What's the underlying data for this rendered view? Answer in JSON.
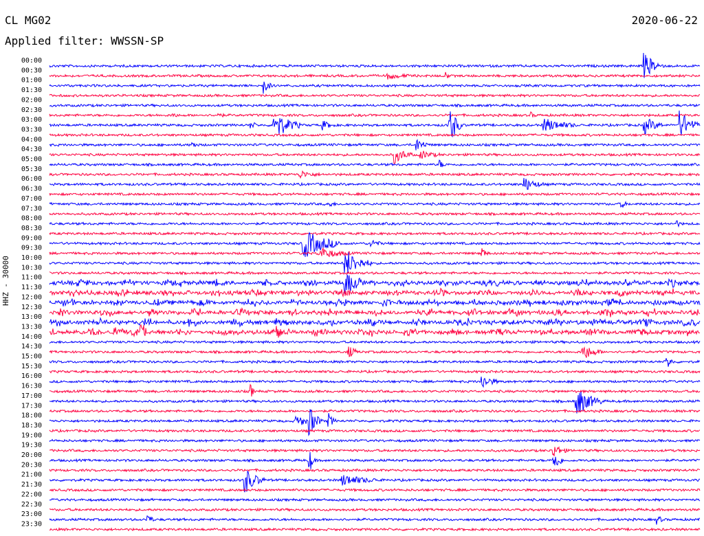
{
  "header": {
    "station": "CL MG02",
    "date": "2020-06-22",
    "filter": "Applied filter: WWSSN-SP",
    "ylabel": "HHZ - 30000"
  },
  "colors": {
    "trace_a": "#0000ff",
    "trace_b": "#ff0040",
    "text": "#000000"
  },
  "chart_data": {
    "type": "line",
    "description_type": "helicorder",
    "rows": [
      "00:00",
      "00:30",
      "01:00",
      "01:30",
      "02:00",
      "02:30",
      "03:00",
      "03:30",
      "04:00",
      "04:30",
      "05:00",
      "05:30",
      "06:00",
      "06:30",
      "07:00",
      "07:30",
      "08:00",
      "08:30",
      "09:00",
      "09:30",
      "10:00",
      "10:30",
      "11:00",
      "11:30",
      "12:00",
      "12:30",
      "13:00",
      "13:30",
      "14:00",
      "14:30",
      "15:00",
      "15:30",
      "16:00",
      "16:30",
      "17:00",
      "17:30",
      "18:00",
      "18:30",
      "19:00",
      "19:30",
      "20:00",
      "20:30",
      "21:00",
      "21:30",
      "22:00",
      "22:30",
      "23:00",
      "23:30"
    ],
    "row_minutes": 30,
    "series_colors": [
      "blue",
      "red"
    ],
    "events": [
      {
        "row": 0,
        "pos": 0.915,
        "amp": 18,
        "dur": 0.03
      },
      {
        "row": 1,
        "pos": 0.52,
        "amp": 4,
        "dur": 0.04
      },
      {
        "row": 1,
        "pos": 0.61,
        "amp": 6,
        "dur": 0.005
      },
      {
        "row": 2,
        "pos": 0.33,
        "amp": 12,
        "dur": 0.012
      },
      {
        "row": 5,
        "pos": 0.19,
        "amp": 4,
        "dur": 0.008
      },
      {
        "row": 5,
        "pos": 0.26,
        "amp": 4,
        "dur": 0.008
      },
      {
        "row": 5,
        "pos": 0.74,
        "amp": 4,
        "dur": 0.008
      },
      {
        "row": 6,
        "pos": 0.31,
        "amp": 5,
        "dur": 0.01
      },
      {
        "row": 6,
        "pos": 0.345,
        "amp": 22,
        "dur": 0.04
      },
      {
        "row": 6,
        "pos": 0.42,
        "amp": 6,
        "dur": 0.02
      },
      {
        "row": 6,
        "pos": 0.615,
        "amp": 30,
        "dur": 0.02
      },
      {
        "row": 6,
        "pos": 0.76,
        "amp": 10,
        "dur": 0.05
      },
      {
        "row": 6,
        "pos": 0.915,
        "amp": 12,
        "dur": 0.03
      },
      {
        "row": 6,
        "pos": 0.97,
        "amp": 20,
        "dur": 0.03
      },
      {
        "row": 8,
        "pos": 0.22,
        "amp": 4,
        "dur": 0.01
      },
      {
        "row": 8,
        "pos": 0.565,
        "amp": 9,
        "dur": 0.02
      },
      {
        "row": 9,
        "pos": 0.53,
        "amp": 12,
        "dur": 0.03
      },
      {
        "row": 9,
        "pos": 0.57,
        "amp": 6,
        "dur": 0.03
      },
      {
        "row": 10,
        "pos": 0.6,
        "amp": 6,
        "dur": 0.01
      },
      {
        "row": 11,
        "pos": 0.385,
        "amp": 5,
        "dur": 0.03
      },
      {
        "row": 12,
        "pos": 0.73,
        "amp": 10,
        "dur": 0.03
      },
      {
        "row": 14,
        "pos": 0.43,
        "amp": 4,
        "dur": 0.01
      },
      {
        "row": 14,
        "pos": 0.88,
        "amp": 5,
        "dur": 0.01
      },
      {
        "row": 16,
        "pos": 0.965,
        "amp": 4,
        "dur": 0.008
      },
      {
        "row": 18,
        "pos": 0.39,
        "amp": 22,
        "dur": 0.06
      },
      {
        "row": 18,
        "pos": 0.495,
        "amp": 7,
        "dur": 0.015
      },
      {
        "row": 19,
        "pos": 0.415,
        "amp": 8,
        "dur": 0.05
      },
      {
        "row": 19,
        "pos": 0.665,
        "amp": 8,
        "dur": 0.01
      },
      {
        "row": 20,
        "pos": 0.455,
        "amp": 20,
        "dur": 0.04
      },
      {
        "row": 22,
        "pos": 0.455,
        "amp": 14,
        "dur": 0.03
      },
      {
        "row": 27,
        "pos": 0.1,
        "amp": 8,
        "dur": 0.02
      },
      {
        "row": 27,
        "pos": 0.14,
        "amp": 8,
        "dur": 0.02
      },
      {
        "row": 27,
        "pos": 0.35,
        "amp": 8,
        "dur": 0.02
      },
      {
        "row": 29,
        "pos": 0.46,
        "amp": 10,
        "dur": 0.015
      },
      {
        "row": 29,
        "pos": 0.82,
        "amp": 12,
        "dur": 0.03
      },
      {
        "row": 30,
        "pos": 0.95,
        "amp": 10,
        "dur": 0.01
      },
      {
        "row": 32,
        "pos": 0.665,
        "amp": 10,
        "dur": 0.025
      },
      {
        "row": 33,
        "pos": 0.31,
        "amp": 10,
        "dur": 0.005
      },
      {
        "row": 34,
        "pos": 0.81,
        "amp": 22,
        "dur": 0.04
      },
      {
        "row": 36,
        "pos": 0.38,
        "amp": 8,
        "dur": 0.03
      },
      {
        "row": 36,
        "pos": 0.4,
        "amp": 20,
        "dur": 0.02
      },
      {
        "row": 36,
        "pos": 0.43,
        "amp": 10,
        "dur": 0.01
      },
      {
        "row": 39,
        "pos": 0.775,
        "amp": 10,
        "dur": 0.02
      },
      {
        "row": 40,
        "pos": 0.4,
        "amp": 16,
        "dur": 0.01
      },
      {
        "row": 40,
        "pos": 0.775,
        "amp": 18,
        "dur": 0.015
      },
      {
        "row": 42,
        "pos": 0.3,
        "amp": 20,
        "dur": 0.03
      },
      {
        "row": 42,
        "pos": 0.45,
        "amp": 8,
        "dur": 0.06
      },
      {
        "row": 46,
        "pos": 0.15,
        "amp": 10,
        "dur": 0.01
      },
      {
        "row": 46,
        "pos": 0.935,
        "amp": 6,
        "dur": 0.01
      }
    ],
    "noisy_rows": [
      22,
      23,
      24,
      25,
      26,
      27
    ]
  }
}
